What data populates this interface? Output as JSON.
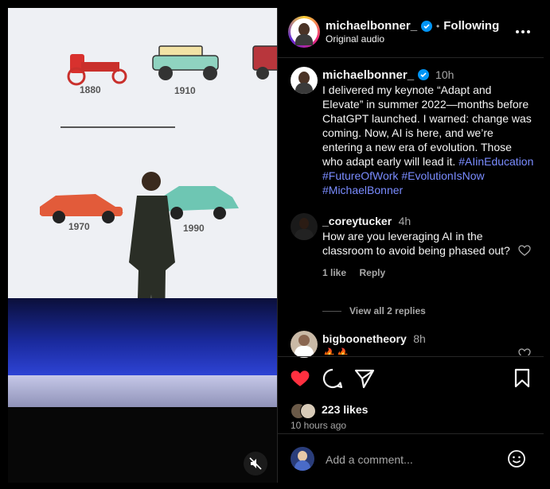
{
  "video": {
    "slide_years": [
      "1880",
      "1910",
      "1970",
      "1990"
    ],
    "mute_icon": "speaker-muted-icon"
  },
  "header": {
    "username": "michaelbonner_",
    "separator": "•",
    "follow_label": "Following",
    "audio_label": "Original audio",
    "more_icon": "more-options-icon"
  },
  "caption": {
    "username": "michaelbonner_",
    "time": "10h",
    "text": "I delivered my keynote “Adapt and Elevate” in summer 2022—months before ChatGPT launched. I warned: change was coming. Now, AI is here, and we’re entering a new era of evolution. Those who adapt early will lead it.",
    "hashtags": [
      "#AIinEducation",
      "#FutureOfWork",
      "#EvolutionIsNow",
      "#MichaelBonner"
    ]
  },
  "comments": [
    {
      "username": "_coreytucker",
      "time": "4h",
      "text": "How are you leveraging AI in the classroom to avoid being phased out?",
      "likes": "1 like",
      "reply_label": "Reply",
      "view_replies": "View all 2 replies"
    },
    {
      "username": "bigboonetheory",
      "time": "8h",
      "text": "🔥🔥"
    }
  ],
  "actions": {
    "likes": "223 likes",
    "timestamp": "10 hours ago",
    "add_comment_placeholder": "Add a comment..."
  },
  "colors": {
    "like_red": "#ff3040",
    "link_blue": "#7a8cff",
    "verified_blue": "#0095f6"
  }
}
